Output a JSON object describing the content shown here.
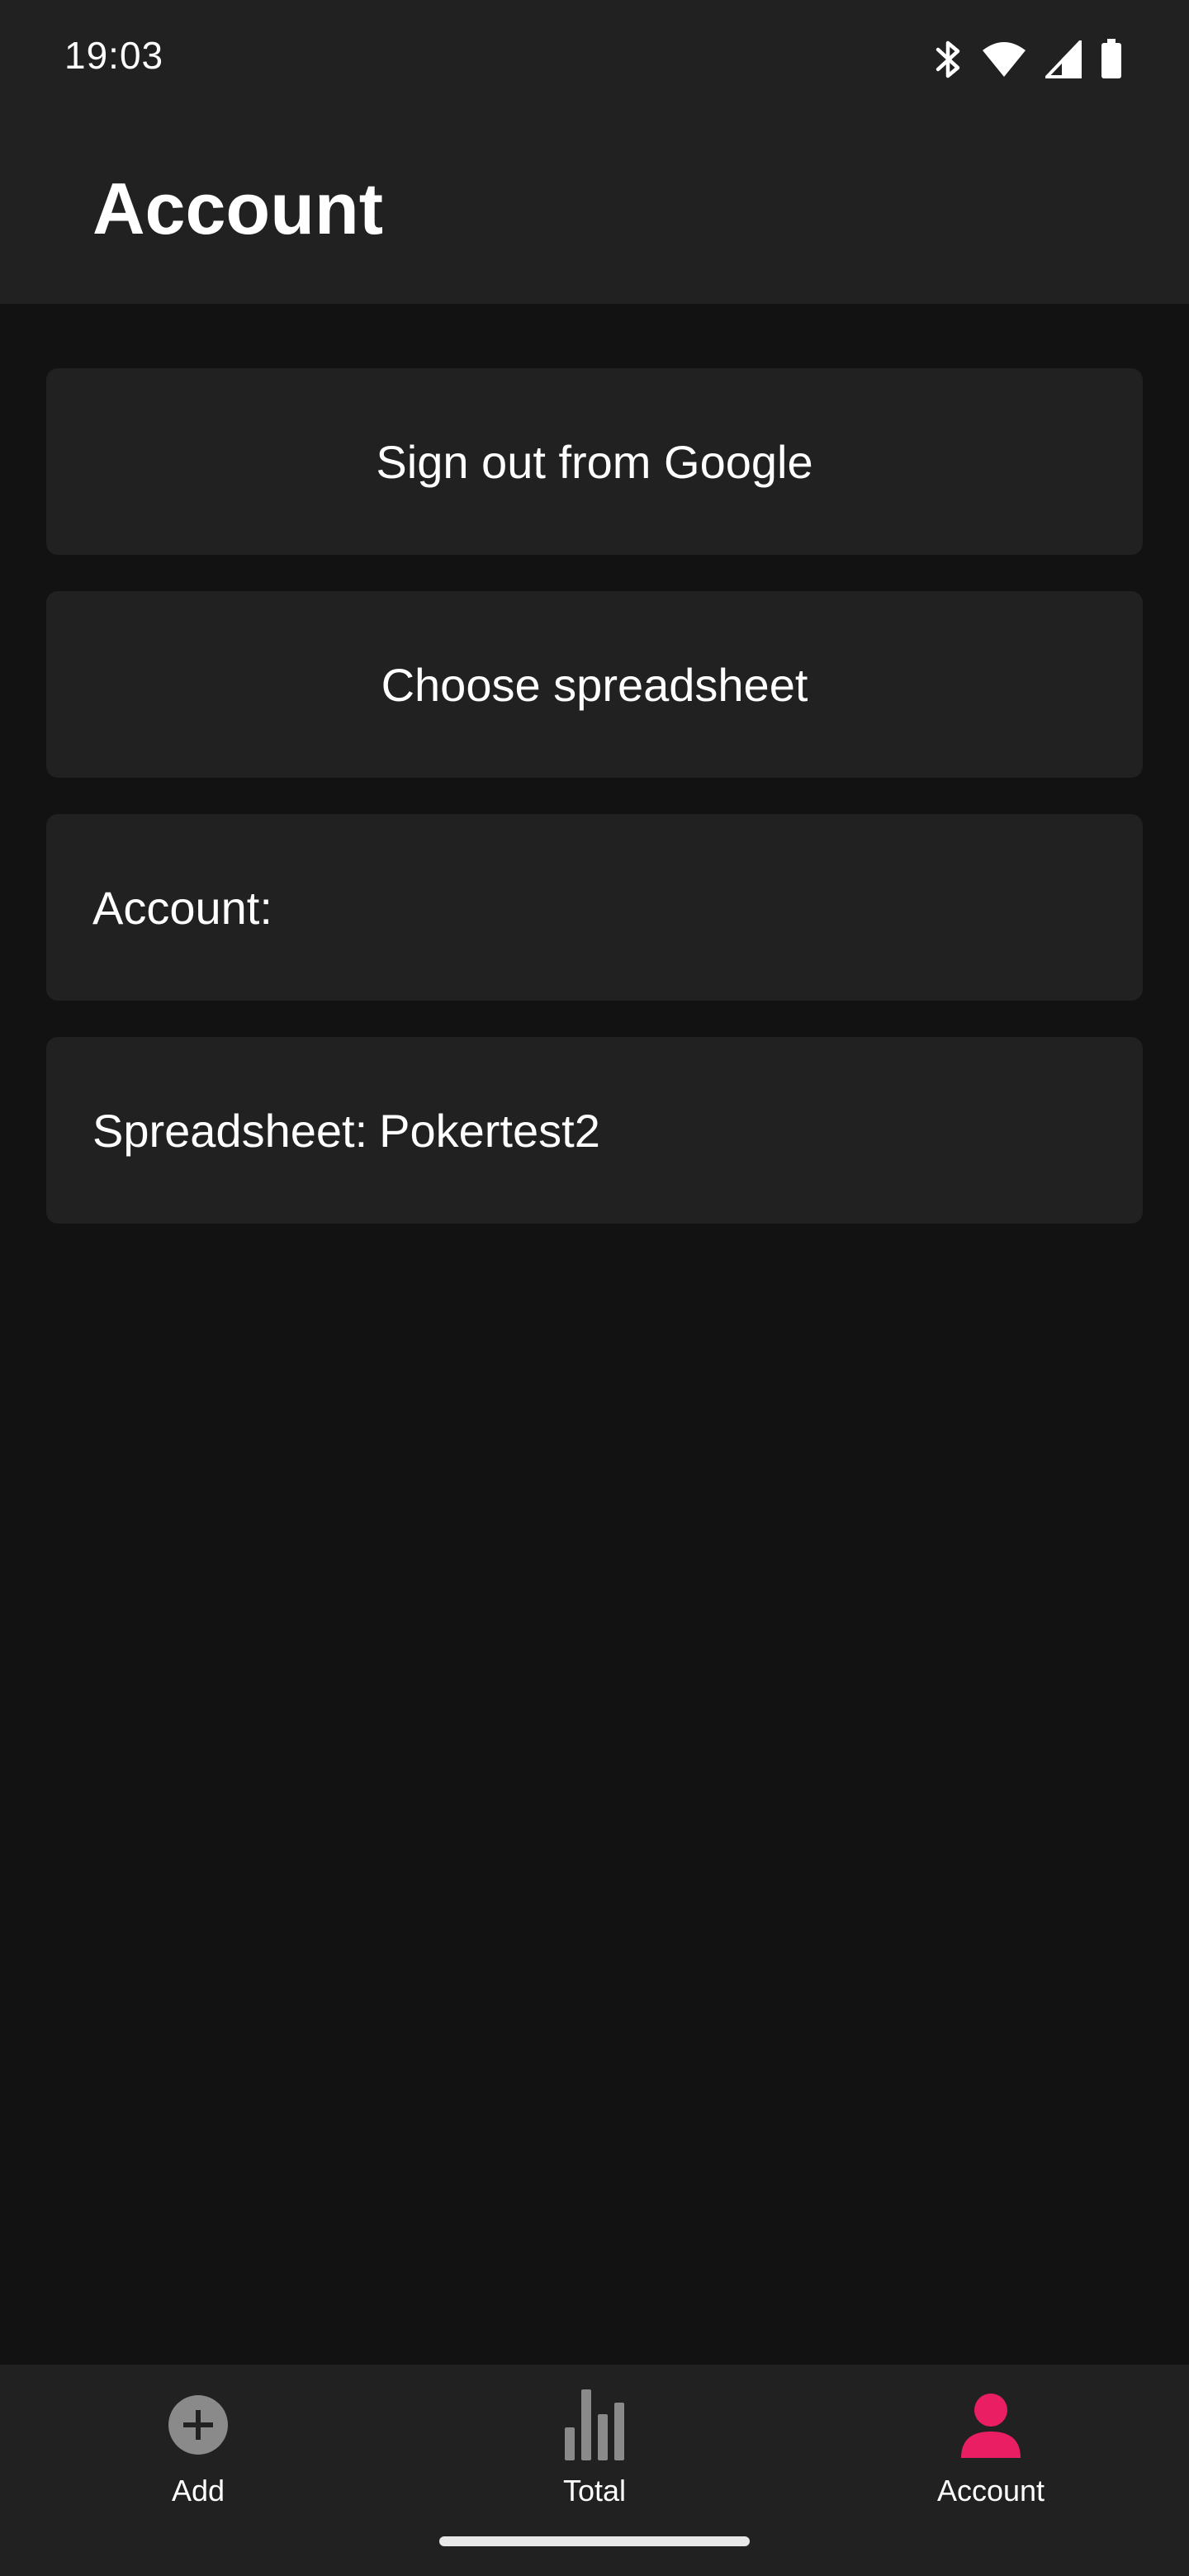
{
  "status_bar": {
    "time": "19:03",
    "icons": [
      "bluetooth-icon",
      "wifi-icon",
      "cell-signal-icon",
      "battery-icon"
    ]
  },
  "app_bar": {
    "title": "Account"
  },
  "actions": {
    "sign_out_label": "Sign out from Google",
    "choose_spreadsheet_label": "Choose spreadsheet"
  },
  "info": {
    "account_label": "Account:",
    "account_value": "",
    "spreadsheet_label": "Spreadsheet:",
    "spreadsheet_value": "Pokertest2"
  },
  "bottom_nav": {
    "items": [
      {
        "label": "Add",
        "icon": "add-circle-icon",
        "active": false
      },
      {
        "label": "Total",
        "icon": "bar-chart-icon",
        "active": false
      },
      {
        "label": "Account",
        "icon": "person-icon",
        "active": true
      }
    ]
  },
  "colors": {
    "background": "#121212",
    "surface": "#212121",
    "accent": "#E91E63",
    "inactive_icon": "#8a8a8a",
    "text": "#ffffff"
  }
}
